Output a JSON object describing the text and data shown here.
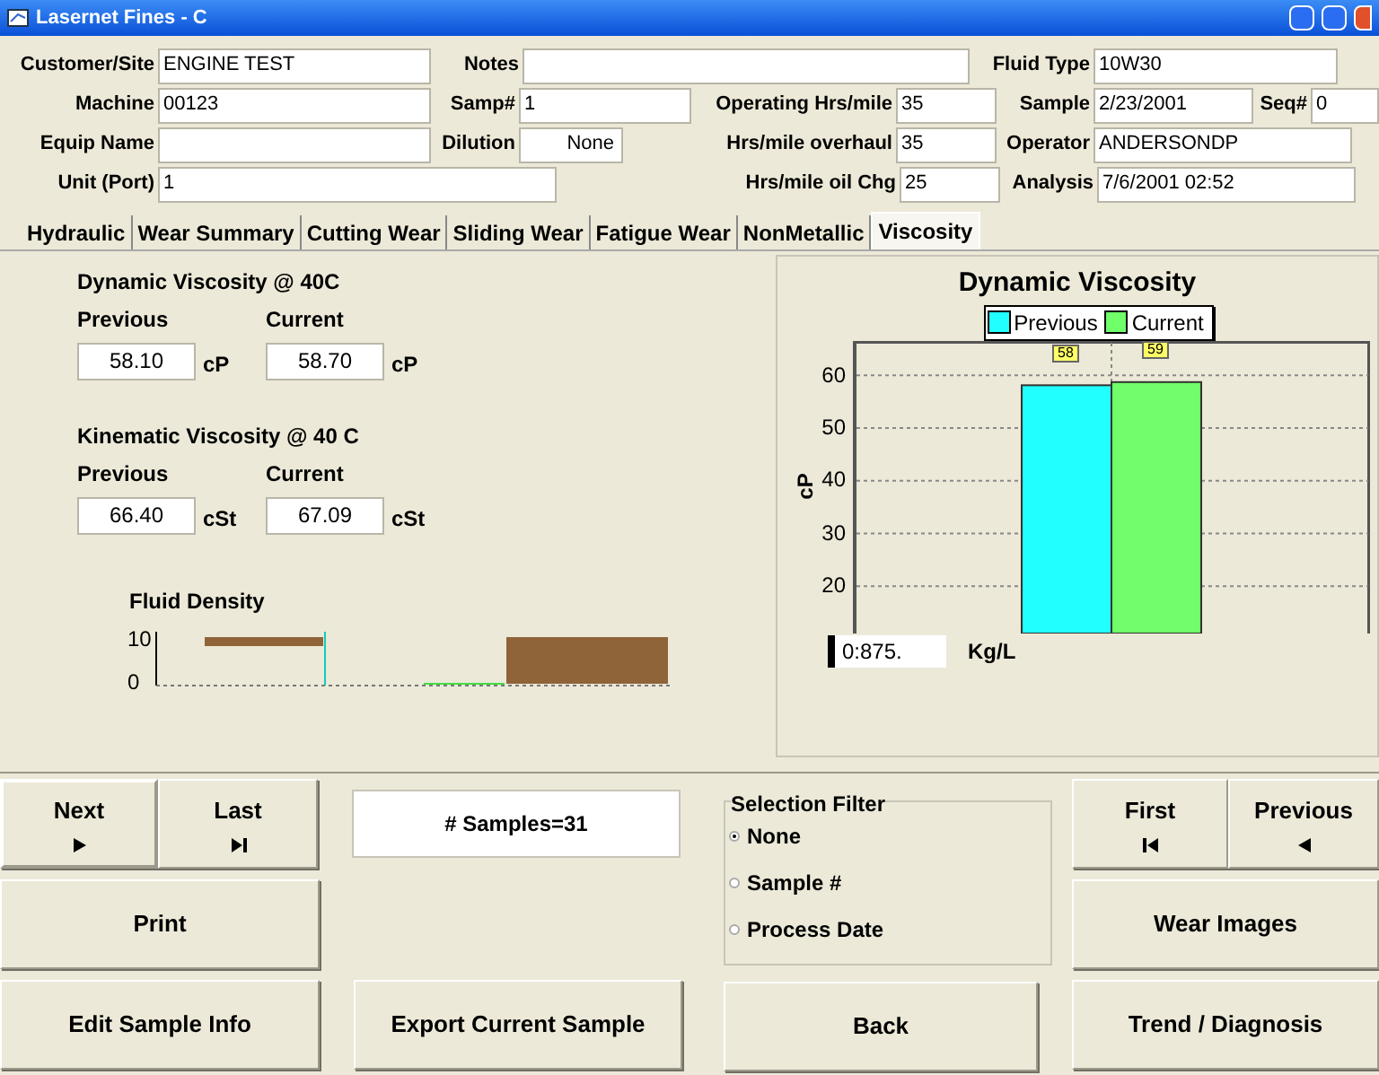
{
  "window": {
    "title": "Lasernet Fines - C"
  },
  "header": {
    "rows": [
      [
        {
          "label": "Customer/Site",
          "value": "ENGINE TEST"
        },
        {
          "label": "Notes"
        },
        "",
        {
          "label": "Fluid Type",
          "value": "10W30"
        }
      ],
      [
        {
          "label": "Machine",
          "value": "00123"
        },
        {
          "label": "Samp#",
          "value": "1"
        },
        {
          "label": "Operating Hrs/mile",
          "value": "35"
        },
        {
          "label": "Sample",
          "value": "2/23/2001"
        },
        {
          "label": "Seq#",
          "value": "0"
        }
      ],
      [
        {
          "label": "Equip Name"
        },
        {
          "label": "Dilution",
          "value": "None"
        },
        {
          "label": "Hrs/mile overhaul",
          "value": "35"
        },
        {
          "label": "Operator",
          "value": "ANDERSONDP"
        }
      ],
      [
        {
          "label": "Unit (Port)",
          "value": "1"
        },
        "",
        {
          "label": "Hrs/mile oil Chg",
          "value": "25"
        },
        {
          "label": "Analysis",
          "value": "7/6/2001 02:52"
        }
      ]
    ]
  },
  "tabs": [
    {
      "label": "Hydraulic",
      "selected": false
    },
    {
      "label": "Wear Summary",
      "selected": false
    },
    {
      "label": "Cutting Wear",
      "selected": false
    },
    {
      "label": "Sliding Wear",
      "selected": false
    },
    {
      "label": "Fatigue Wear",
      "selected": false
    },
    {
      "label": "NonMetallic",
      "selected": false
    },
    {
      "label": "Viscosity",
      "selected": true
    }
  ],
  "viscosity_groups": [
    {
      "title": "Dynamic Viscosity @ 40C",
      "previous_label": "Previous",
      "current_label": "Current",
      "previous": "58.10",
      "current": "58.70",
      "previous_unit": "cP",
      "current_unit": "cP"
    },
    {
      "title": "Kinematic Viscosity @ 40 C",
      "previous_label": "Previous",
      "current_label": "Current",
      "previous": "66.40",
      "current": "67.09",
      "previous_unit": "cSt",
      "current_unit": "cSt"
    }
  ],
  "fluid_density": {
    "label": "Fluid Density",
    "ticks": [
      "10",
      "0"
    ],
    "value": "0:875.",
    "unit": "Kg/L"
  },
  "chart": {
    "chart_data": {
      "type": "bar",
      "title": "Dynamic Viscosity",
      "ylabel": "cP",
      "categories": [
        null
      ],
      "grid": true,
      "series": [
        {
          "name": "Previous",
          "color": "#22ffff",
          "values": [
            58.1
          ]
        },
        {
          "name": "Current",
          "color": "#70ff6a",
          "values": [
            58.7
          ]
        }
      ],
      "ylim": [
        11,
        66.5
      ],
      "yticks": [
        20,
        30,
        40,
        50,
        60
      ],
      "value_labels": [
        "58",
        "59"
      ]
    }
  },
  "navigation": {
    "next": "Next",
    "last": "Last",
    "first": "First",
    "previous": "Previous"
  },
  "samples_count": "# Samples=31",
  "selection_filter": {
    "title": "Selection Filter",
    "options": [
      {
        "label": "None",
        "selected": true
      },
      {
        "label": "Sample #",
        "selected": false
      },
      {
        "label": "Process Date",
        "selected": false
      }
    ]
  },
  "buttons": {
    "print": "Print",
    "edit_sample_info": "Edit Sample Info",
    "export_current_sample": "Export Current Sample",
    "back": "Back",
    "wear_images": "Wear Images",
    "trend_diagnosis": "Trend / Diagnosis"
  }
}
